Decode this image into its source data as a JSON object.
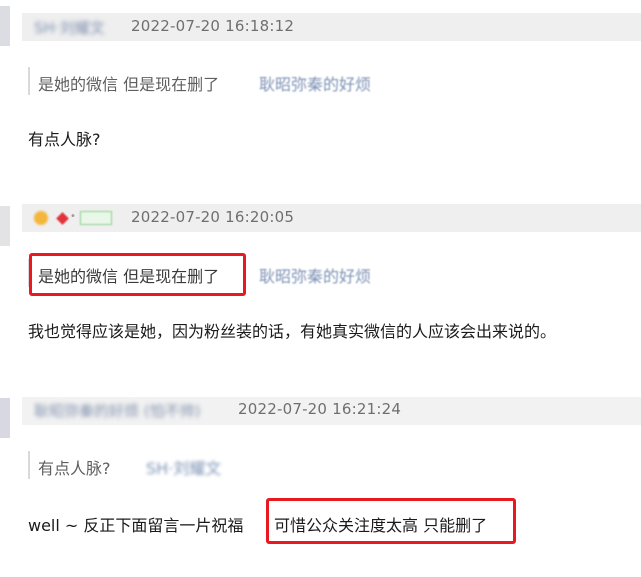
{
  "comments": [
    {
      "user_name": "SH·刘耀文",
      "timestamp": "2022-07-20 16:18:12",
      "quote_text": "是她的微信 但是现在删了",
      "quote_author": "耿昭弥秦的好烦",
      "body": "有点人脉?"
    },
    {
      "timestamp": "2022-07-20 16:20:05",
      "quote_text": "是她的微信 但是现在删了",
      "quote_author": "耿昭弥秦的好烦",
      "body": "我也觉得应该是她，因为粉丝装的话，有她真实微信的人应该会出来说的。"
    },
    {
      "user_name": "耿昭弥秦的好烦 (怕不帅)",
      "timestamp": "2022-07-20 16:21:24",
      "quote_text": "有点人脉?",
      "quote_author": "SH·刘耀文",
      "body_part1": "well ~  反正下面留言一片祝福 ",
      "body_part2": "可惜公众关注度太高 只能删了"
    }
  ],
  "colors": {
    "highlight_box": "#e8191f",
    "link": "#7e93b5",
    "meta": "#6f6f6f",
    "header_band": "#efefef"
  }
}
